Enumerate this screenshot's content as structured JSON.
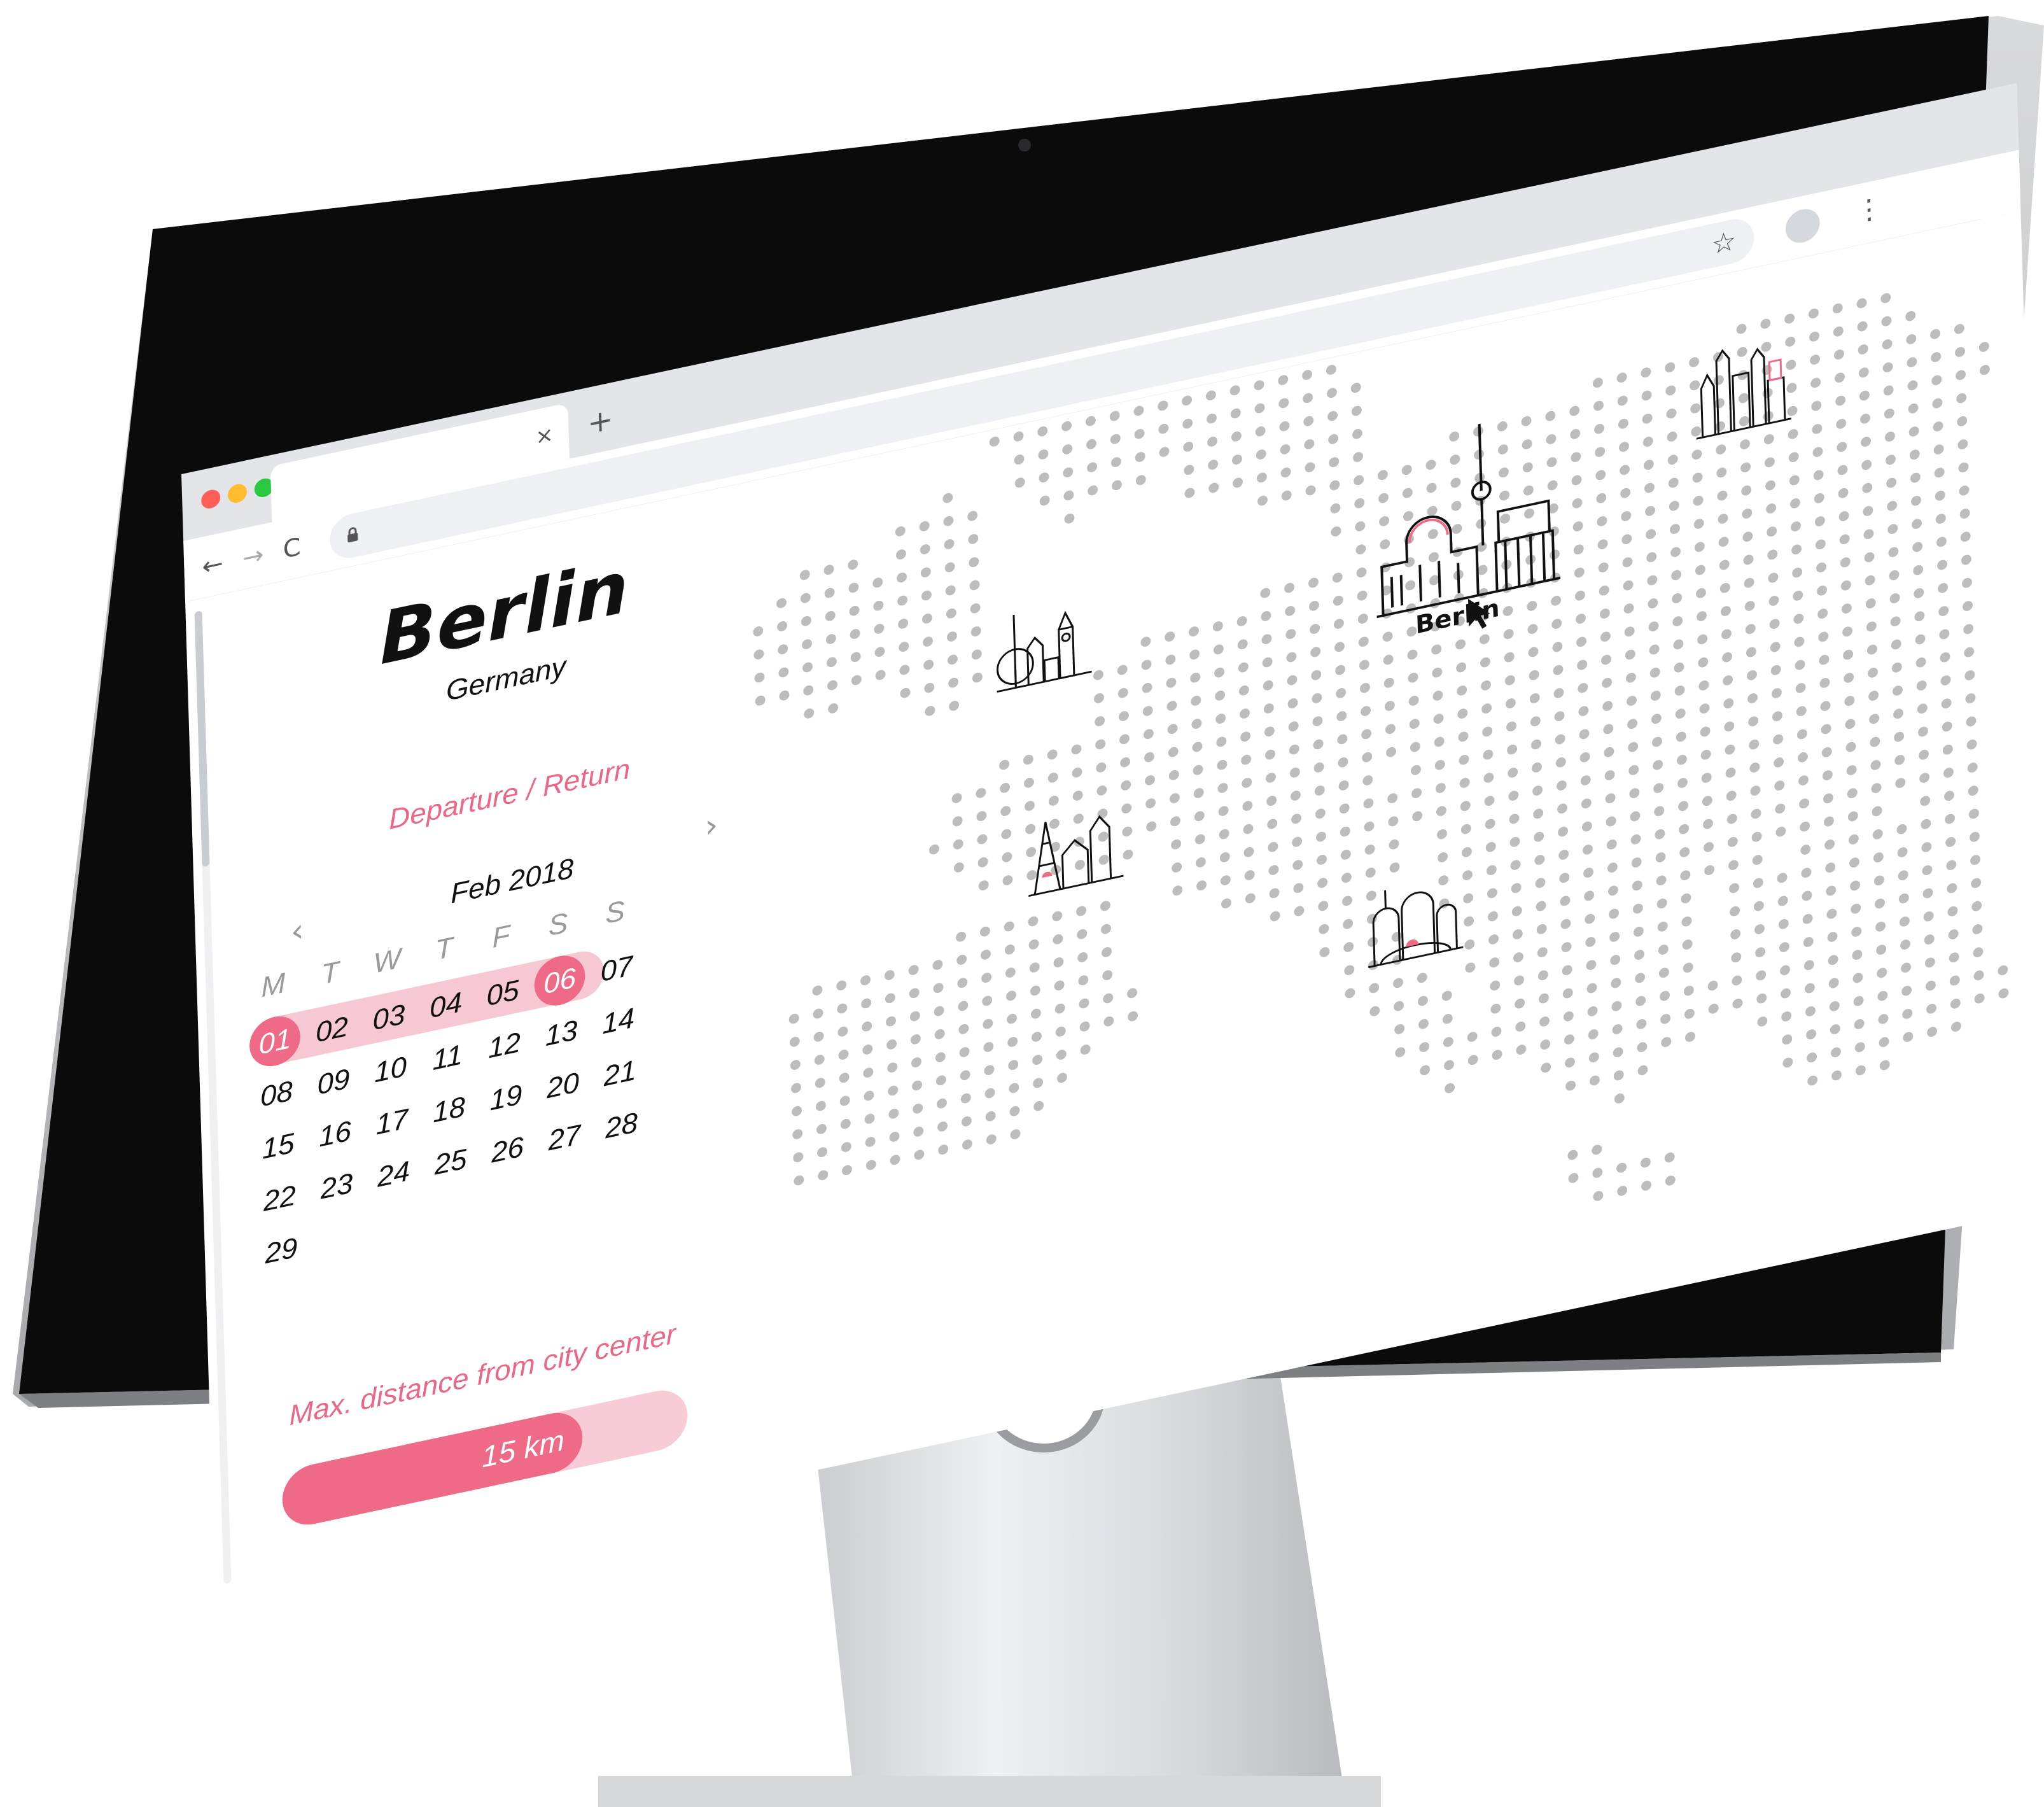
{
  "browser": {
    "tab_close": "×",
    "new_tab": "+",
    "back": "←",
    "forward": "→",
    "reload": "C",
    "star": "☆",
    "menu": "⋮",
    "traffic_lights": [
      "#ff5f57",
      "#febc2e",
      "#28c840"
    ]
  },
  "sidebar": {
    "city": "Berlin",
    "country": "Germany",
    "dates_label": "Departure / Return",
    "calendar": {
      "month": "Feb 2018",
      "prev": "‹",
      "next": "›",
      "weekdays": [
        "M",
        "T",
        "W",
        "T",
        "F",
        "S",
        "S"
      ],
      "weeks": [
        [
          "01",
          "02",
          "03",
          "04",
          "05",
          "06",
          "07"
        ],
        [
          "08",
          "09",
          "10",
          "11",
          "12",
          "13",
          "14"
        ],
        [
          "15",
          "16",
          "17",
          "18",
          "19",
          "20",
          "21"
        ],
        [
          "22",
          "23",
          "24",
          "25",
          "26",
          "27",
          "28"
        ],
        [
          "29"
        ]
      ],
      "range_start": "01",
      "range_end": "06"
    },
    "distance_label": "Max. distance from city center",
    "distance_value": "15 km",
    "distance_fraction": 0.74
  },
  "map": {
    "selected_city_label": "Berlin",
    "markers": [
      "london-skyline-icon",
      "paris-skyline-icon",
      "berlin-skyline-icon",
      "moscow-skyline-icon",
      "rome-skyline-icon"
    ],
    "cursor": "mouse-pointer-icon"
  },
  "colors": {
    "accent": "#ef6a86",
    "accent_light": "#f6c8d3",
    "map_dot": "#bdbdbd"
  }
}
